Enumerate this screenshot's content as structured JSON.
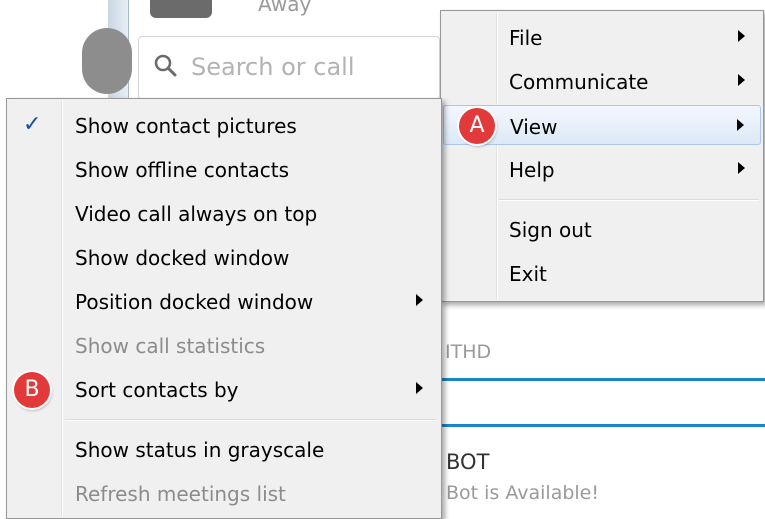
{
  "background": {
    "status_text": "Away",
    "search_placeholder": "Search or call",
    "partial_label": "ITHD",
    "contact_name": "BOT",
    "contact_status": "Bot is Available!"
  },
  "main_menu": {
    "items": [
      {
        "label": "File",
        "has_submenu": true
      },
      {
        "label": "Communicate",
        "has_submenu": true
      },
      {
        "label": "View",
        "has_submenu": true,
        "highlighted": true
      },
      {
        "label": "Help",
        "has_submenu": true
      },
      {
        "label": "Sign out",
        "has_submenu": false
      },
      {
        "label": "Exit",
        "has_submenu": false
      }
    ]
  },
  "view_submenu": {
    "items": [
      {
        "label": "Show contact pictures",
        "checked": true
      },
      {
        "label": "Show offline contacts"
      },
      {
        "label": "Video call always on top"
      },
      {
        "label": "Show docked window"
      },
      {
        "label": "Position docked window",
        "has_submenu": true
      },
      {
        "label": "Show call statistics",
        "disabled": true
      },
      {
        "label": "Sort contacts by",
        "has_submenu": true
      },
      {
        "label": "Show status in grayscale"
      },
      {
        "label": "Refresh meetings list",
        "disabled": true
      }
    ]
  },
  "annotations": {
    "a": "A",
    "b": "B"
  },
  "colors": {
    "badge": "#e23a3a",
    "highlight_border": "#a8c8ed",
    "accent_line": "#1a86c8",
    "check": "#1a4ea1"
  },
  "icons": {
    "check": "✓",
    "search": "search-icon"
  }
}
